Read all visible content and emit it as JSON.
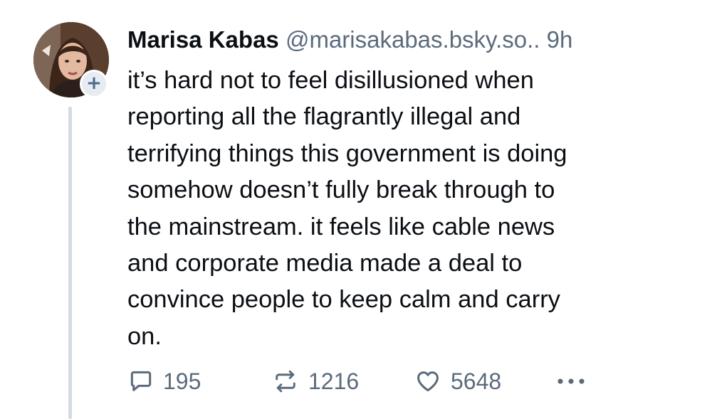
{
  "post": {
    "author": {
      "display_name": "Marisa Kabas",
      "handle": "@marisakabas.bsky.so..",
      "avatar_icon": "user-avatar-photo",
      "follow_icon": "plus-icon",
      "follow_label": "+"
    },
    "time_ago": "9h",
    "text": "it’s hard not to feel disillusioned when\nreporting all the flagrantly illegal and\nterrifying things this government is doing\nsomehow doesn’t fully break through to\nthe mainstream. it feels like cable news\nand corporate media made a deal to\nconvince people to keep calm and carry\non.",
    "actions": {
      "reply": {
        "icon": "reply-icon",
        "count": "195"
      },
      "repost": {
        "icon": "repost-icon",
        "count": "1216"
      },
      "like": {
        "icon": "heart-icon",
        "count": "5648"
      },
      "more": {
        "icon": "more-options-icon"
      }
    }
  },
  "colors": {
    "text": "#0b0f14",
    "muted": "#5b6b7c",
    "thread_line": "#d4dbe2",
    "badge_bg": "#e6ecf2"
  }
}
